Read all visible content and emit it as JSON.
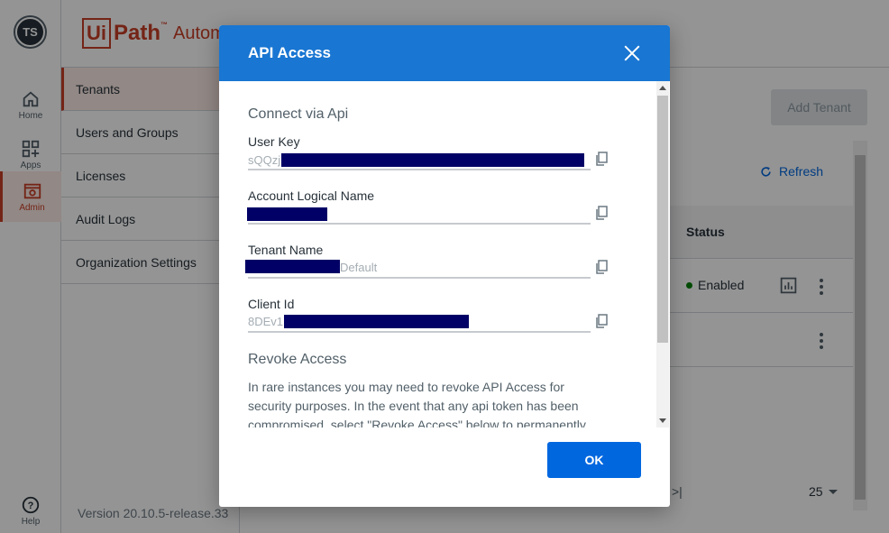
{
  "rail": {
    "avatar": "TS",
    "items": [
      {
        "label": "Home",
        "icon": "home-icon"
      },
      {
        "label": "Apps",
        "icon": "apps-icon"
      },
      {
        "label": "Admin",
        "icon": "admin-icon"
      }
    ],
    "help": "Help"
  },
  "brand": {
    "box": "Ui",
    "rest": "Path",
    "tm": "™",
    "tail": "Autom"
  },
  "sidebar": {
    "items": [
      "Tenants",
      "Users and Groups",
      "Licenses",
      "Audit Logs",
      "Organization Settings"
    ],
    "version": "Version 20.10.5-release.33"
  },
  "main": {
    "add_tenant": "Add Tenant",
    "refresh": "Refresh",
    "column_status": "Status",
    "row_status": "Enabled",
    "pager_last": ">|",
    "page_size": "25"
  },
  "dialog": {
    "title": "API Access",
    "connect_title": "Connect via Api",
    "fields": [
      {
        "label": "User Key",
        "visible": "sQQzj"
      },
      {
        "label": "Account Logical Name",
        "visible": ""
      },
      {
        "label": "Tenant Name",
        "visible": "Default"
      },
      {
        "label": "Client Id",
        "visible": "8DEv1"
      }
    ],
    "revoke_title": "Revoke Access",
    "revoke_text": "In rare instances you may need to revoke API Access for security purposes. In the event that any api token has been compromised, select \"Revoke Access\" below to permanently",
    "ok": "OK"
  },
  "colors": {
    "brand": "#c83e26",
    "header": "#1976d2",
    "primary": "#0067df",
    "redaction": "#000066"
  }
}
